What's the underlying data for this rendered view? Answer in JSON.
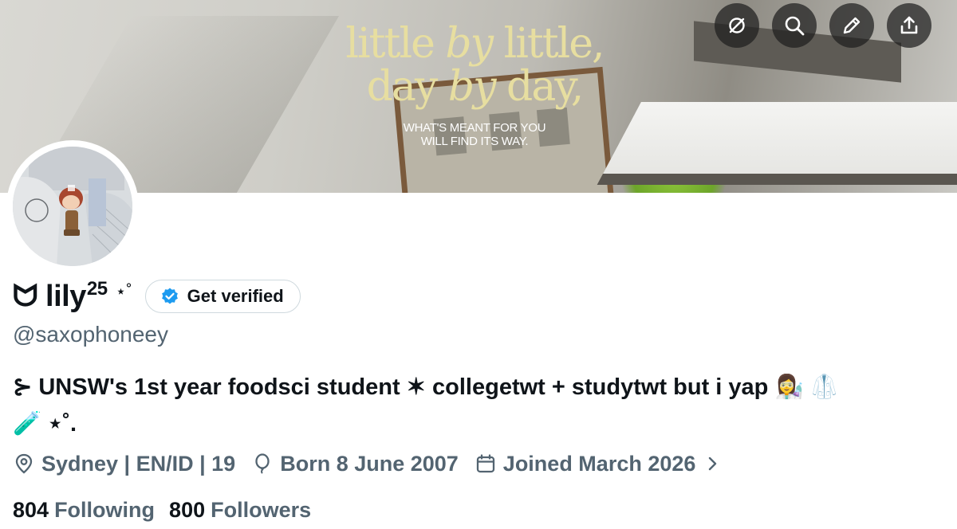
{
  "banner": {
    "quote_line1_a": "little ",
    "quote_line1_b": "by",
    "quote_line1_c": " little,",
    "quote_line2_a": "day ",
    "quote_line2_b": "by",
    "quote_line2_c": " day,",
    "quote_sub1": "WHAT'S MEANT FOR YOU",
    "quote_sub2": "WILL FIND ITS WAY.",
    "buttons": [
      "no-wifi-icon",
      "search-icon",
      "edit-icon",
      "share-icon"
    ]
  },
  "profile": {
    "name_prefix": "ᗢ",
    "name": "lily",
    "name_sup": "25",
    "name_deco": "⋆˚",
    "verify_label": "Get verified",
    "handle": "@saxophoneey",
    "bio_line1": "⊱ UNSW's 1st year foodsci student ✶ collegetwt + studytwt but i yap 👩‍🔬 🥼",
    "bio_line2": "🧪 ⋆˚."
  },
  "meta": {
    "location": "Sydney | EN/ID | 19",
    "born": "Born 8 June 2007",
    "joined": "Joined March 2026"
  },
  "stats": {
    "following_count": "804",
    "following_label": "Following",
    "followers_count": "800",
    "followers_label": "Followers"
  },
  "colors": {
    "text_primary": "#0f1419",
    "text_secondary": "#536471",
    "verified_blue": "#1d9bf0",
    "quote_yellow": "#e7dea0"
  }
}
